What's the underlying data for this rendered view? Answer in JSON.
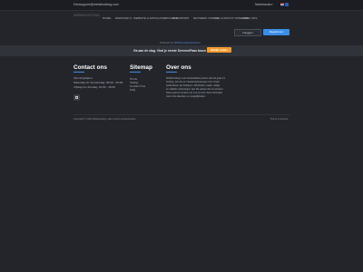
{
  "topbar": {
    "email": "Devsupport@webshosting.com",
    "language": "Nederlands",
    "language_caret": "▾",
    "flags": [
      "nl",
      "en"
    ]
  },
  "header": {
    "logo": "WEBSHOSTING",
    "nav": [
      "HOME",
      "DIENSTEN ▾",
      "WEBSITE & APPLICATIEBOUWEN",
      "IT SUPPORT",
      "NETWERK STATUS",
      "FAQ",
      "CONTACT OPNEMEN",
      "OVER ONS"
    ]
  },
  "hero": {
    "login_label": "Inloggen",
    "register_label": "Registreren",
    "powered_prefix": "Powered by",
    "powered_link": "WHMCompleteSolution"
  },
  "cta": {
    "text": "Ga aan de slag. Vind je eerste Servers/Paas bouw hier!",
    "button": "Bekijk opties"
  },
  "footer": {
    "contact": {
      "title": "Contact ons",
      "lines": [
        "Openingstijden",
        "Maandag t/m Donderdag: 09:00 - 20:00",
        "Vrijdag t/m Zondag: 10:00 - 16:00"
      ]
    },
    "sitemap": {
      "title": "Sitemap",
      "links": [
        "Home",
        "Veiling",
        "Contact Ons",
        "FAQ"
      ]
    },
    "about": {
      "title": "Over ons",
      "lines": [
        "Webshosting is een betrouwbaar partner als het gaat om",
        "hosting, servers en netwerkoplossingen voor zowel",
        "particulieren als bedrijven. Wij bieden snelle, veilige",
        "en stabiele oplossingen aan die passen bij uw wensen.",
        "Neem gerust contact met ons op voor meer informatie",
        "over onze diensten en mogelijkheden."
      ]
    },
    "copyright": "Copyright © 2024 WebsHosting. Alle rechten voorbehouden.",
    "terms": "Terms of Service"
  },
  "colors": {
    "background": "#23252b",
    "accent": "#3a8ee6",
    "cta_button": "#f39c2b"
  }
}
